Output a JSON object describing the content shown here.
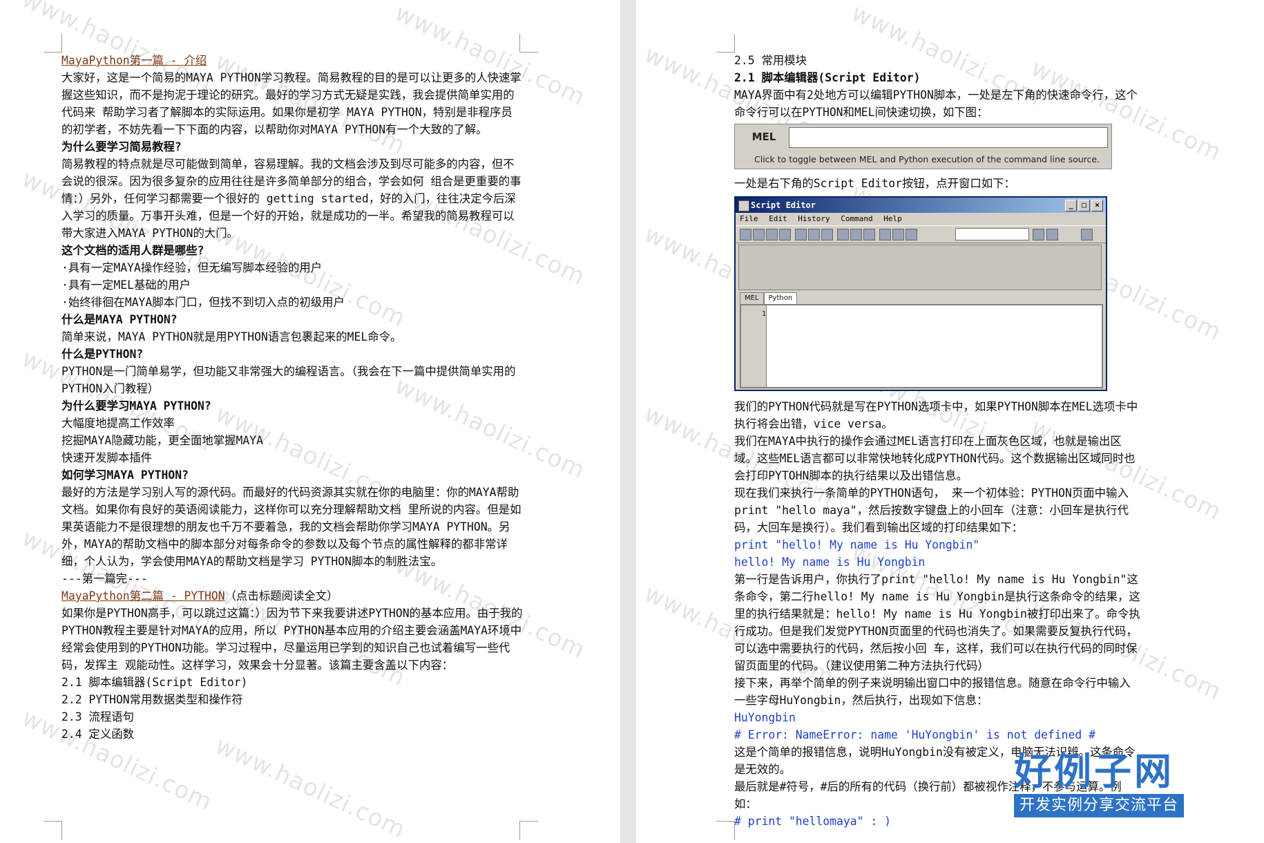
{
  "left": {
    "link1": "MayaPython第一篇 - 介绍",
    "p1": "大家好，这是一个简易的MAYA PYTHON学习教程。简易教程的目的是可以让更多的人快速掌握这些知识，而不是拘泥于理论的研究。最好的学习方式无疑是实践，我会提供简单实用的代码来 帮助学习者了解脚本的实际运用。如果你是初学 MAYA PYTHON，特别是非程序员的初学者，不妨先看一下下面的内容，以帮助你对MAYA PYTHON有一个大致的了解。",
    "h1": "为什么要学习简易教程?",
    "p2": "简易教程的特点就是尽可能做到简单，容易理解。我的文档会涉及到尽可能多的内容，但不会说的很深。因为很多复杂的应用往往是许多简单部分的组合，学会如何 组合是更重要的事情：）另外，任何学习都需要一个很好的 getting started，好的入门，往往决定今后深入学习的质量。万事开头难，但是一个好的开始，就是成功的一半。希望我的简易教程可以带大家进入MAYA PYTHON的大门。",
    "h2": "这个文档的适用人群是哪些?",
    "bullets": [
      "·具有一定MAYA操作经验，但无编写脚本经验的用户",
      "·具有一定MEL基础的用户",
      "·始终徘徊在MAYA脚本门口，但找不到切入点的初级用户"
    ],
    "h3": "什么是MAYA PYTHON?",
    "p3": "简单来说，MAYA PYTHON就是用PYTHON语言包裹起来的MEL命令。",
    "h4": "什么是PYTHON?",
    "p4": "PYTHON是一门简单易学，但功能又非常强大的编程语言。（我会在下一篇中提供简单实用的PYTHON入门教程）",
    "h5": "为什么要学习MAYA PYTHON?",
    "reasons": [
      "大幅度地提高工作效率",
      "挖掘MAYA隐藏功能，更全面地掌握MAYA",
      "快速开发脚本插件"
    ],
    "h6": "如何学习MAYA PYTHON?",
    "p5": "最好的方法是学习别人写的源代码。而最好的代码资源其实就在你的电脑里：你的MAYA帮助文档。如果你有良好的英语阅读能力，这样你可以充分理解帮助文档 里所说的内容。但是如果英语能力不是很理想的朋友也千万不要着急，我的文档会帮助你学习MAYA PYTHON。另外，MAYA的帮助文档中的脚本部分对每条命令的参数以及每个节点的属性解释的都非常详细，个人认为，学会使用MAYA的帮助文档是学习 PYTHON脚本的制胜法宝。",
    "end1": "---第一篇完---",
    "link2": "MayaPython第二篇 - PYTHON",
    "link2_suffix": "（点击标题阅读全文）",
    "p6": "如果你是PYTHON高手，可以跳过这篇：）因为节下来我要讲述PYTHON的基本应用。由于我的PYTHON教程主要是针对MAYA的应用，所以 PYTHON基本应用的介绍主要会涵盖MAYA环境中经常会使用到的PYTHON功能。学习过程中，尽量运用已学到的知识自己也试着编写一些代码，发挥主 观能动性。这样学习，效果会十分显著。该篇主要含盖以下内容：",
    "toc": [
      "2.1 脚本编辑器(Script Editor)",
      "2.2 PYTHON常用数据类型和操作符",
      "2.3 流程语句",
      "2.4 定义函数"
    ]
  },
  "right": {
    "toc5": "2.5 常用模块",
    "h1": "2.1 脚本编辑器(Script Editor)",
    "p1": "MAYA界面中有2处地方可以编辑PYTHON脚本，一处是左下角的快速命令行，这个命令行可以在PYTHON和MEL间快速切换，如下图：",
    "mel_label": "MEL",
    "mel_help": "Click to toggle between MEL and Python execution of the command line source.",
    "p2": "一处是右下角的Script Editor按钮，点开窗口如下：",
    "se_title": "Script Editor",
    "se_menu": [
      "File",
      "Edit",
      "History",
      "Command",
      "Help"
    ],
    "se_tabs": [
      "MEL",
      "Python"
    ],
    "se_line": "1",
    "p3": "我们的PYTHON代码就是写在PYTHON选项卡中，如果PYTHON脚本在MEL选项卡中执行将会出错，vice versa。",
    "p4": "我们在MAYA中执行的操作会通过MEL语言打印在上面灰色区域，也就是输出区域。这些MEL语言都可以非常快地转化成PYTHON代码。这个数据输出区域同时也会打印PYTOHN脚本的执行结果以及出错信息。",
    "p5": "现在我们来执行一条简单的PYTHON语句， 来一个初体验：PYTHON页面中输入 print \"hello maya\"，然后按数字键盘上的小回车（注意：小回车是执行代码，大回车是换行）。我们看到输出区域的打印结果如下：",
    "code1": "print \"hello! My name is Hu Yongbin\"",
    "code2": "hello! My name is Hu Yongbin",
    "p6": "第一行是告诉用户，你执行了print \"hello! My name is Hu Yongbin\"这条命令，第二行hello! My name is Hu Yongbin是执行这条命令的结果，这里的执行结果就是：hello! My name is Hu Yongbin被打印出来了。命令执行成功。但是我们发觉PYTHON页面里的代码也消失了。如果需要反复执行代码，可以选中需要执行的代码，然后按小回 车，这样，我们可以在执行代码的同时保留页面里的代码。（建议使用第二种方法执行代码）",
    "p7": "接下来，再举个简单的例子来说明输出窗口中的报错信息。随意在命令行中输入一些字母HuYongbin，然后执行，出现如下信息：",
    "code3": "HuYongbin",
    "code4": "# Error: NameError: name 'HuYongbin' is not defined #",
    "p8": "这是个简单的报错信息，说明HuYongbin没有被定义，电脑无法识辨。这条命令是无效的。",
    "p9": "最后就是#符号，#后的所有的代码（换行前）都被视作注释，不参与运算。例如：",
    "code5": "# print \"hellomaya\" : )"
  },
  "watermark": "www.haolizi.com",
  "logo": {
    "title": "好例子网",
    "subtitle": "开发实例分享交流平台"
  },
  "colors": {
    "link": "#7a3b17",
    "code": "#1f3fc8",
    "logo": "#2e72c5",
    "gutter": "#e6e6e6"
  }
}
